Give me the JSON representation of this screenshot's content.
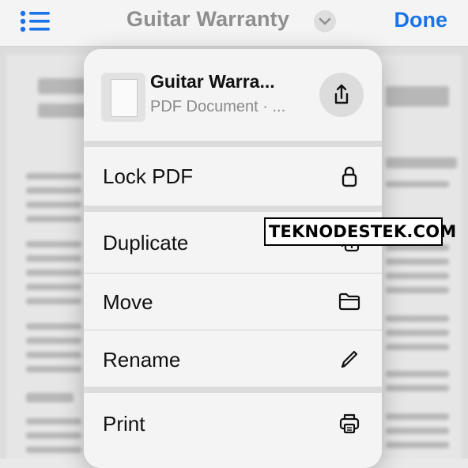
{
  "nav": {
    "title": "Guitar Warranty",
    "done_label": "Done",
    "list_icon": "list-icon",
    "chevron_icon": "chevron-down-icon"
  },
  "menu": {
    "header": {
      "file_name": "Guitar Warra...",
      "file_meta": "PDF Document · ...",
      "share_icon": "share-icon"
    },
    "items": [
      {
        "label": "Lock PDF",
        "icon": "lock-icon"
      },
      {
        "label": "Duplicate",
        "icon": "duplicate-icon"
      },
      {
        "label": "Move",
        "icon": "folder-icon"
      },
      {
        "label": "Rename",
        "icon": "pencil-icon"
      },
      {
        "label": "Print",
        "icon": "printer-icon"
      }
    ]
  },
  "watermark": {
    "text": "TEKNODESTEK.COM"
  },
  "colors": {
    "accent": "#1a73e8"
  }
}
